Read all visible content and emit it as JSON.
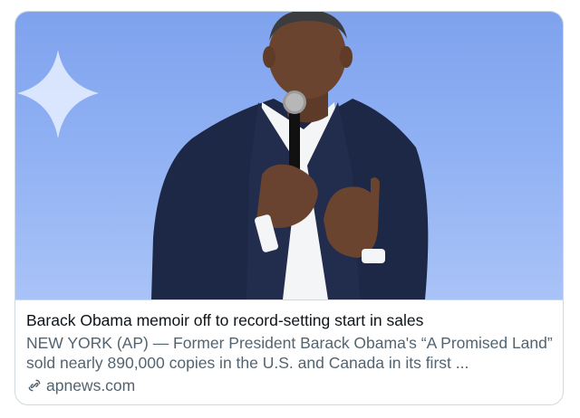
{
  "card": {
    "title": "Barack Obama memoir off to record-setting start in sales",
    "description": "NEW YORK (AP) — Former President Barack Obama's “A Promised Land” sold nearly 890,000 copies in the U.S. and Canada in its first ...",
    "domain": "apnews.com"
  },
  "colors": {
    "title": "#0f1419",
    "secondary": "#536471",
    "border": "#cfd9de",
    "image_background": "#8fb0f3"
  },
  "icons": {
    "link": "link-icon",
    "sparkle": "sparkle-decoration"
  }
}
